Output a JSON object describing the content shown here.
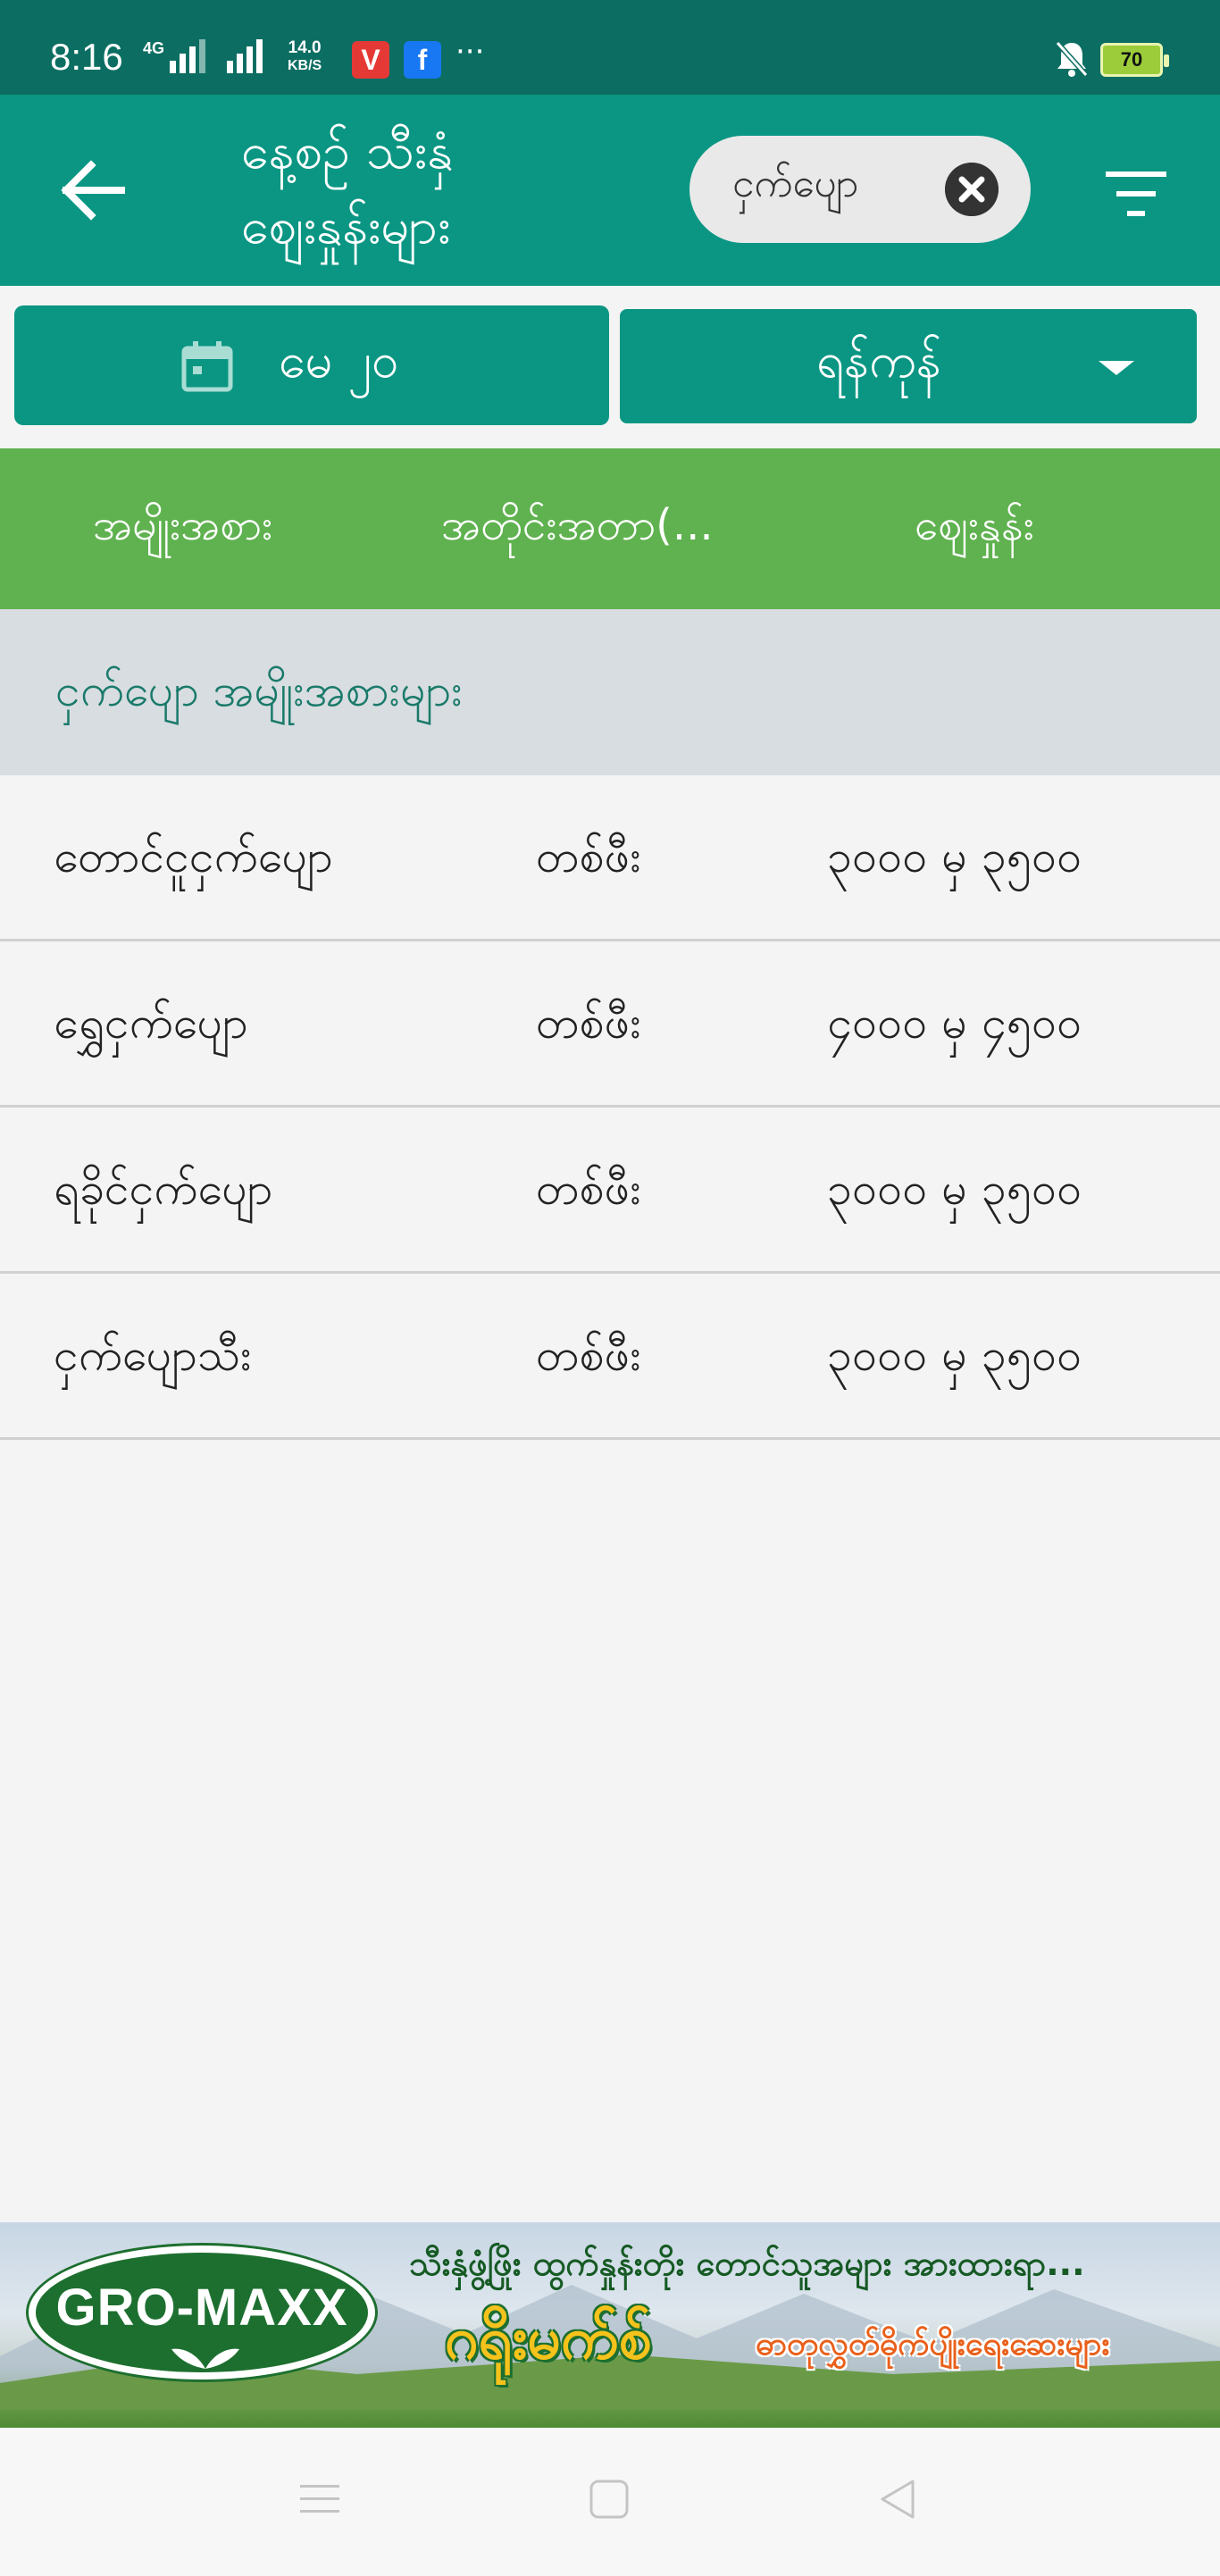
{
  "status_bar": {
    "time": "8:16",
    "network_label": "4G",
    "speed_value": "14.0",
    "speed_unit": "KB/S",
    "app_icon_1": "V",
    "app_icon_2": "f",
    "more": "···",
    "battery": "70",
    "icons": [
      "signal-icon",
      "mute-icon",
      "battery-icon"
    ]
  },
  "header": {
    "title_line1": "နေ့စဉ် သီးနှံ",
    "title_line2": "ဈေးနှုန်းများ",
    "search_chip_text": "ငှက်ပျော",
    "icons": [
      "back-arrow-icon",
      "close-icon",
      "filter-icon"
    ],
    "colors": {
      "primary": "#0a9683",
      "status_bar": "#0c6e62"
    }
  },
  "selectors": {
    "date_label": "မေ ၂၀",
    "city_label": "ရန်ကုန်",
    "icons": [
      "calendar-icon",
      "dropdown-caret-icon"
    ]
  },
  "table": {
    "header_color": "#5fb24f",
    "columns": [
      "အမျိုးအစား",
      "အတိုင်းအတာ(...",
      "ဈေးနှုန်း"
    ],
    "group_title": "ငှက်ပျော အမျိုးအစားများ",
    "rows": [
      {
        "name": "တောင်ငူငှက်ပျော",
        "unit": "တစ်ဖီး",
        "price": "၃၀၀၀ မှ ၃၅၀၀"
      },
      {
        "name": "ရွှေငှက်ပျော",
        "unit": "တစ်ဖီး",
        "price": "၄၀၀၀ မှ ၄၅၀၀"
      },
      {
        "name": "ရခိုင်ငှက်ပျော",
        "unit": "တစ်ဖီး",
        "price": "၃၀၀၀ မှ ၃၅၀၀"
      },
      {
        "name": "ငှက်ပျောသီး",
        "unit": "တစ်ဖီး",
        "price": "၃၀၀၀ မှ ၃၅၀၀"
      }
    ]
  },
  "ad": {
    "logo": "GRO-MAXX",
    "tagline": "သီးနှံဖွံ့ဖြိုး ထွက်နှုန်းတိုး တောင်သူအများ အားထားရာ...",
    "brand": "ဂရိုးမက်စ်",
    "sub": "ဓာတုလွှတ်ဓိုက်ပျိုးရေးဆေးများ"
  },
  "nav": {
    "icons": [
      "menu-icon",
      "home-square-icon",
      "back-triangle-icon"
    ]
  }
}
